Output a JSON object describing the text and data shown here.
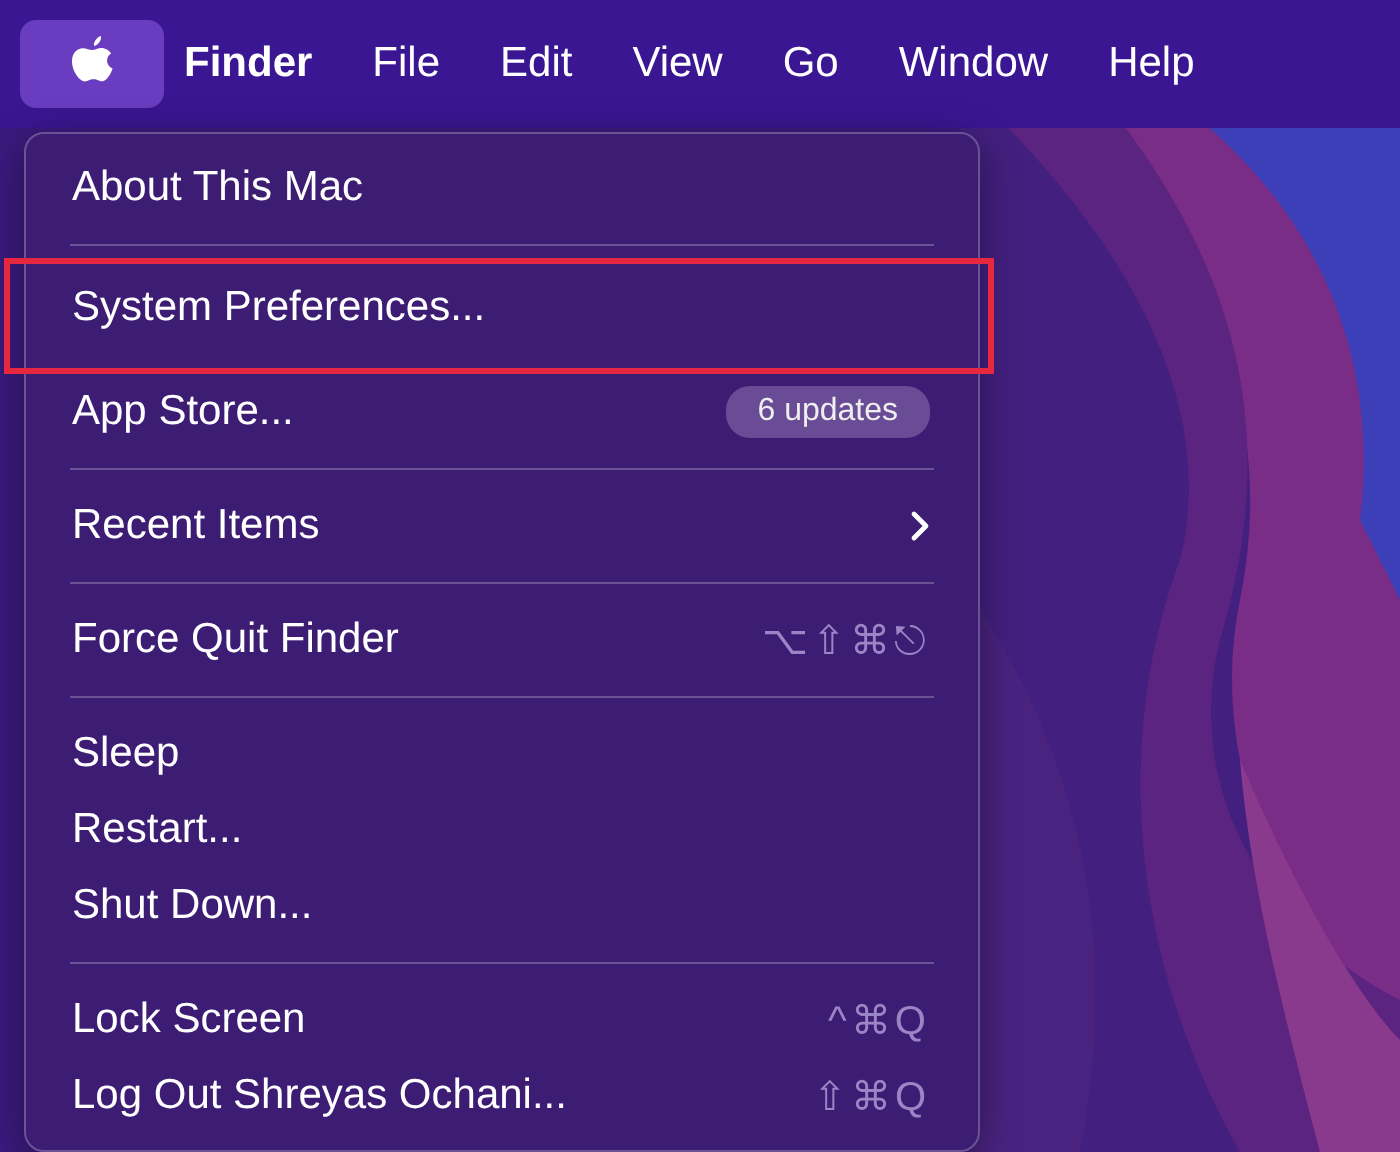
{
  "menu_bar": {
    "apple_menu_open": true,
    "items": [
      {
        "label": "Finder",
        "bold": true
      },
      {
        "label": "File",
        "bold": false
      },
      {
        "label": "Edit",
        "bold": false
      },
      {
        "label": "View",
        "bold": false
      },
      {
        "label": "Go",
        "bold": false
      },
      {
        "label": "Window",
        "bold": false
      },
      {
        "label": "Help",
        "bold": false
      }
    ]
  },
  "apple_menu": {
    "groups": [
      [
        {
          "label": "About This Mac",
          "highlighted": false
        }
      ],
      [
        {
          "label": "System Preferences...",
          "highlighted": true
        },
        {
          "label": "App Store...",
          "badge": "6 updates",
          "highlighted": false
        }
      ],
      [
        {
          "label": "Recent Items",
          "submenu": true,
          "highlighted": false
        }
      ],
      [
        {
          "label": "Force Quit Finder",
          "shortcut": "⌥⇧⌘⎋",
          "highlighted": false
        }
      ],
      [
        {
          "label": "Sleep",
          "highlighted": false
        },
        {
          "label": "Restart...",
          "highlighted": false
        },
        {
          "label": "Shut Down...",
          "highlighted": false
        }
      ],
      [
        {
          "label": "Lock Screen",
          "shortcut": "^⌘Q",
          "highlighted": false
        },
        {
          "label": "Log Out Shreyas Ochani...",
          "shortcut": "⇧⌘Q",
          "highlighted": false
        }
      ]
    ]
  }
}
